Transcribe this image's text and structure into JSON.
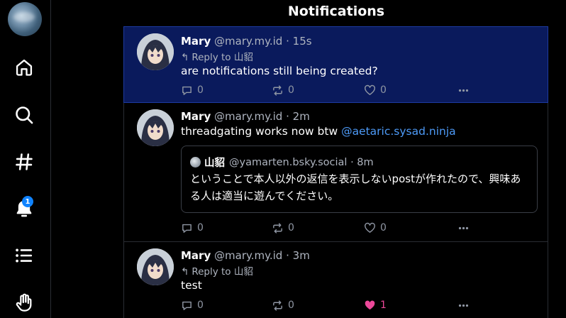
{
  "header": {
    "title": "Notifications"
  },
  "nav": {
    "items": [
      {
        "name": "home",
        "icon": "home-icon"
      },
      {
        "name": "search",
        "icon": "search-icon"
      },
      {
        "name": "feeds",
        "icon": "hash-icon"
      },
      {
        "name": "notifications",
        "icon": "bell-icon",
        "badge": "1"
      },
      {
        "name": "lists",
        "icon": "list-icon"
      },
      {
        "name": "moderation",
        "icon": "hand-icon"
      }
    ]
  },
  "posts": [
    {
      "name": "Mary",
      "handle": "@mary.my.id",
      "dot": "·",
      "time": "15s",
      "reply_to": "Reply to 山貂",
      "text": "are notifications still being created?",
      "replies": "0",
      "reposts": "0",
      "likes": "0",
      "unread": true
    },
    {
      "name": "Mary",
      "handle": "@mary.my.id",
      "dot": "·",
      "time": "2m",
      "text_prefix": "threadgating works now btw ",
      "mention": "@aetaric.sysad.ninja",
      "quote": {
        "name": "山貂",
        "handle": "@yamarten.bsky.social",
        "dot": "·",
        "time": "8m",
        "text": "ということで本人以外の返信を表示しないpostが作れたので、興味ある人は適当に遊んでください。"
      },
      "replies": "0",
      "reposts": "0",
      "likes": "0"
    },
    {
      "name": "Mary",
      "handle": "@mary.my.id",
      "dot": "·",
      "time": "3m",
      "reply_to": "Reply to 山貂",
      "text": "test",
      "replies": "0",
      "reposts": "0",
      "likes": "1",
      "liked": true
    }
  ],
  "colors": {
    "accent": "#1083fe",
    "unread_bg": "#0a1a5c",
    "like": "#ec4899",
    "link": "#4d9af7"
  }
}
